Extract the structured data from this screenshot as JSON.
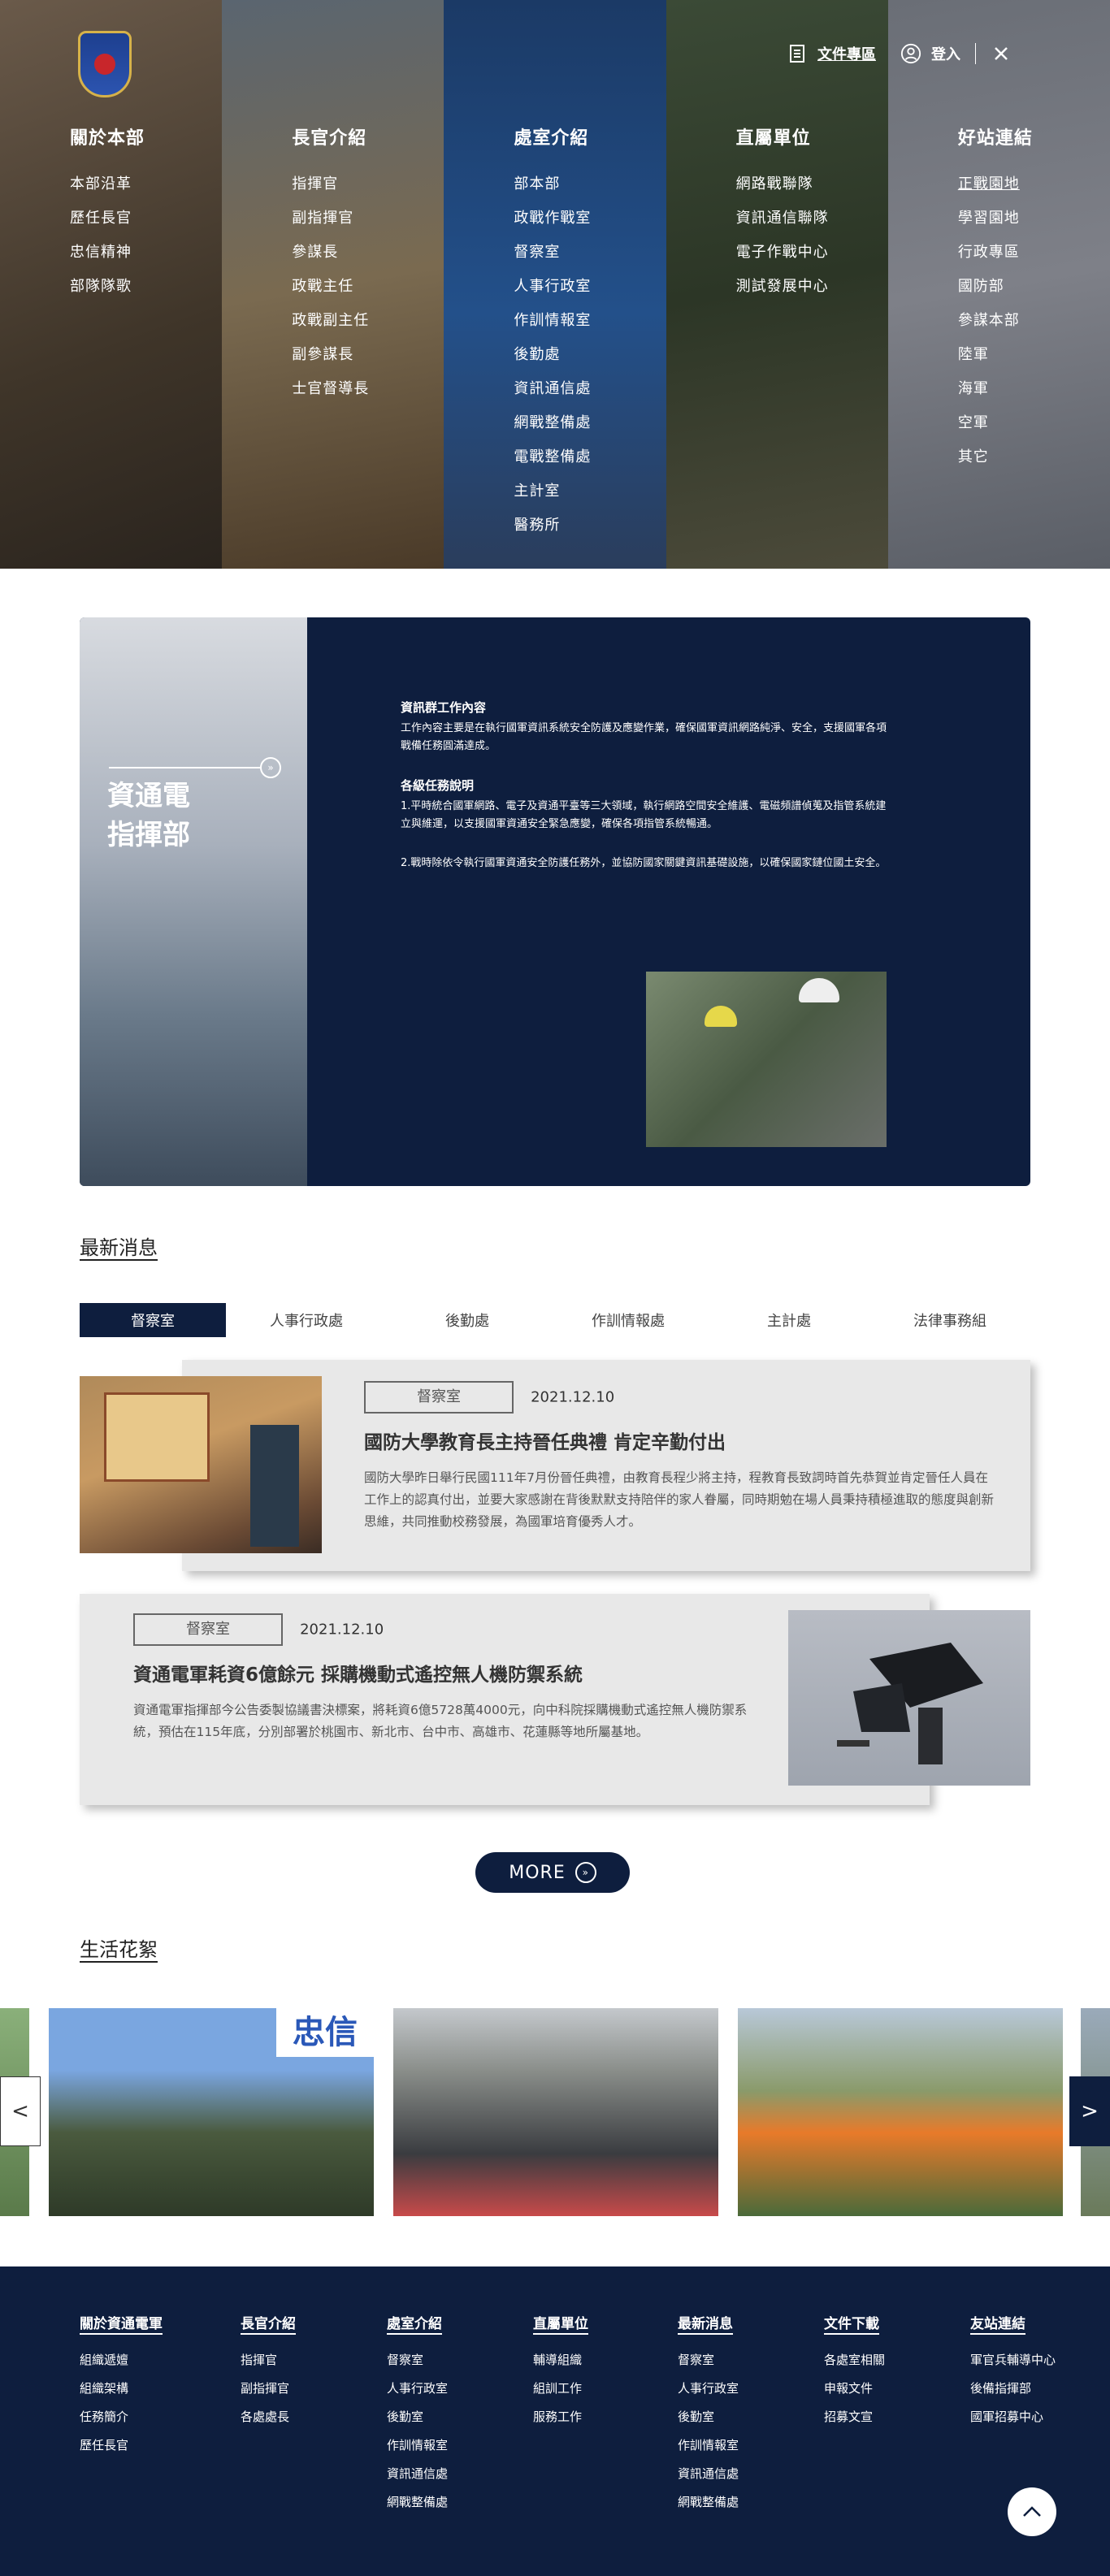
{
  "hero": {
    "columns": [
      {
        "title": "關於本部",
        "items": [
          "本部沿革",
          "歷任長官",
          "忠信精神",
          "部隊隊歌"
        ]
      },
      {
        "title": "長官介紹",
        "items": [
          "指揮官",
          "副指揮官",
          "參謀長",
          "政戰主任",
          "政戰副主任",
          "副參謀長",
          "士官督導長"
        ]
      },
      {
        "title": "處室介紹",
        "items": [
          "部本部",
          "政戰作戰室",
          "督察室",
          "人事行政室",
          "作訓情報室",
          "後勤處",
          "資訊通信處",
          "網戰整備處",
          "電戰整備處",
          "主計室",
          "醫務所"
        ]
      },
      {
        "title": "直屬單位",
        "items": [
          "網路戰聯隊",
          "資訊通信聯隊",
          "電子作戰中心",
          "測試發展中心"
        ]
      },
      {
        "title": "好站連結",
        "items": [
          "正戰園地",
          "學習園地",
          "行政專區",
          "國防部",
          "參謀本部",
          "陸軍",
          "海軍",
          "空軍",
          "其它"
        ]
      }
    ]
  },
  "topbar": {
    "docs": "文件專區",
    "login": "登入"
  },
  "command": {
    "title_line1": "資通電",
    "title_line2": "指揮部",
    "h1": "資訊群工作內容",
    "p1": "工作內容主要是在執行國軍資訊系統安全防護及應變作業，確保國軍資訊網路純淨、安全，支援國軍各項戰備任務圓滿達成。",
    "h2": "各級任務說明",
    "p2": "1.平時統合國軍網路、電子及資通平臺等三大領域，執行網路空間安全維護、電磁頻譜偵蒐及指管系統建立與維運，以支援國軍資通安全緊急應變，確保各項指管系統暢通。",
    "p3": "2.戰時除依令執行國軍資通安全防護任務外，並協防國家關鍵資訊基礎設施，以確保國家鏈位國土安全。"
  },
  "news": {
    "heading": "最新消息",
    "tabs": [
      "督察室",
      "人事行政處",
      "後勤處",
      "作訓情報處",
      "主計處",
      "法律事務組"
    ],
    "items": [
      {
        "tag": "督察室",
        "date": "2021.12.10",
        "title": "國防大學教育長主持晉任典禮 肯定辛勤付出",
        "body": "國防大學昨日舉行民國111年7月份晉任典禮，由教育長程少將主持，程教育長致詞時首先恭賀並肯定晉任人員在工作上的認真付出，並要大家感謝在背後默默支持陪伴的家人眷屬，同時期勉在場人員秉持積極進取的態度與創新思維，共同推動校務發展，為國軍培育優秀人才。"
      },
      {
        "tag": "督察室",
        "date": "2021.12.10",
        "title": "資通電軍耗資6億餘元 採購機動式遙控無人機防禦系統",
        "body": "資通電軍指揮部今公告委製協議書決標案，將耗資6億5728萬4000元，向中科院採購機動式遙控無人機防禦系統，預估在115年底，分別部署於桃園市、新北市、台中市、高雄市、花蓮縣等地所屬基地。"
      }
    ],
    "more": "MORE"
  },
  "life": {
    "heading": "生活花絮",
    "banner_text": "忠信"
  },
  "footer": {
    "columns": [
      {
        "title": "關於資通電軍",
        "items": [
          "組織遞嬗",
          "組織架構",
          "任務簡介",
          "歷任長官"
        ]
      },
      {
        "title": "長官介紹",
        "items": [
          "指揮官",
          "副指揮官",
          "各處處長"
        ]
      },
      {
        "title": "處室介紹",
        "items": [
          "督察室",
          "人事行政室",
          "後勤室",
          "作訓情報室",
          "資訊通信處",
          "網戰整備處"
        ]
      },
      {
        "title": "直屬單位",
        "items": [
          "輔導組織",
          "組訓工作",
          "服務工作"
        ]
      },
      {
        "title": "最新消息",
        "items": [
          "督察室",
          "人事行政室",
          "後勤室",
          "作訓情報室",
          "資訊通信處",
          "網戰整備處"
        ]
      },
      {
        "title": "文件下載",
        "items": [
          "各處室相關",
          "申報文件",
          "招募文宣"
        ]
      },
      {
        "title": "友站連結",
        "items": [
          "軍官兵輔導中心",
          "後備指揮部",
          "國軍招募中心"
        ]
      }
    ]
  }
}
